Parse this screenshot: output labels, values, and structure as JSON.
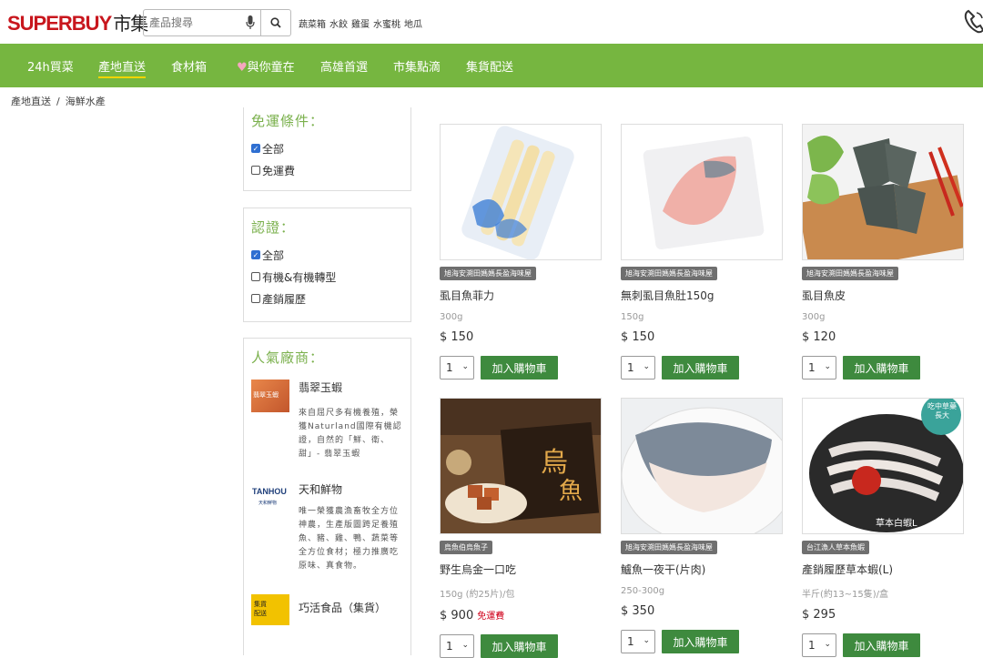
{
  "brand": {
    "name_a": "SUPERBUY",
    "name_b": "市集"
  },
  "search": {
    "placeholder": "產品搜尋",
    "hot": [
      "蔬菜箱",
      "水餃",
      "雞蛋",
      "水蜜桃",
      "地瓜"
    ]
  },
  "nav": [
    "24h買菜",
    "產地直送",
    "食材箱",
    "與你童在",
    "高雄首選",
    "市集點滴",
    "集貨配送"
  ],
  "nav_active": "產地直送",
  "breadcrumb": [
    "產地直送",
    "海鮮水產"
  ],
  "filters": {
    "shipping": {
      "title": "免運條件：",
      "options": [
        "全部",
        "免運費"
      ],
      "checked": "全部"
    },
    "cert": {
      "title": "認證：",
      "options": [
        "全部",
        "有機&有機轉型",
        "產銷履歷"
      ],
      "checked": "全部"
    },
    "vendors_title": "人氣廠商：",
    "vendors": [
      {
        "name": "翡翠玉蝦",
        "desc": "來自屈尺多有機養殖，榮獲Naturland國際有機認證，自然的「鮮、衛、甜」- 翡翠玉蝦",
        "logo_text": "翡翠玉蝦"
      },
      {
        "name": "天和鮮物",
        "desc": "唯一榮獲農漁畜牧全方位神農，生產版圖跨足養殖魚、豬、雞、鴨、蔬菜等全方位食材；極力推廣吃原味、真食物。",
        "logo_text": "TANHOU",
        "logo_sub": "天和鮮物"
      },
      {
        "name": "巧活食品（集貨）",
        "desc": "",
        "logo_text": "集貨配送"
      }
    ]
  },
  "products": [
    {
      "tag": "旭海安溯田媽媽長盈海味屋",
      "name": "虱目魚菲力",
      "spec": "300g",
      "price": "$ 150",
      "free": "",
      "qty": "1"
    },
    {
      "tag": "旭海安溯田媽媽長盈海味屋",
      "name": "無刺虱目魚肚150g",
      "spec": "150g",
      "price": "$ 150",
      "free": "",
      "qty": "1"
    },
    {
      "tag": "旭海安溯田媽媽長盈海味屋",
      "name": "虱目魚皮",
      "spec": "300g",
      "price": "$ 120",
      "free": "",
      "qty": "1"
    },
    {
      "tag": "烏魚伯烏魚子",
      "name": "野生烏金一口吃",
      "spec": "150g (約25片)/包",
      "price": "$ 900",
      "free": "免運費",
      "qty": "1"
    },
    {
      "tag": "旭海安溯田媽媽長盈海味屋",
      "name": "鱸魚一夜干(片肉)",
      "spec": "250-300g",
      "price": "$ 350",
      "free": "",
      "qty": "1"
    },
    {
      "tag": "台江漁人草本魚蝦",
      "name": "產銷履歷草本蝦(L)",
      "spec": "半斤(約13~15隻)/盒",
      "price": "$ 295",
      "free": "",
      "qty": "1",
      "badge": "吃中草藥長大",
      "box_text": "草本白蝦L"
    }
  ],
  "add_to_cart": "加入購物車",
  "colors": {
    "nav": "#76b640",
    "button": "#3e8a3e",
    "brand_red": "#c8161d",
    "title_green": "#7ab04c"
  }
}
